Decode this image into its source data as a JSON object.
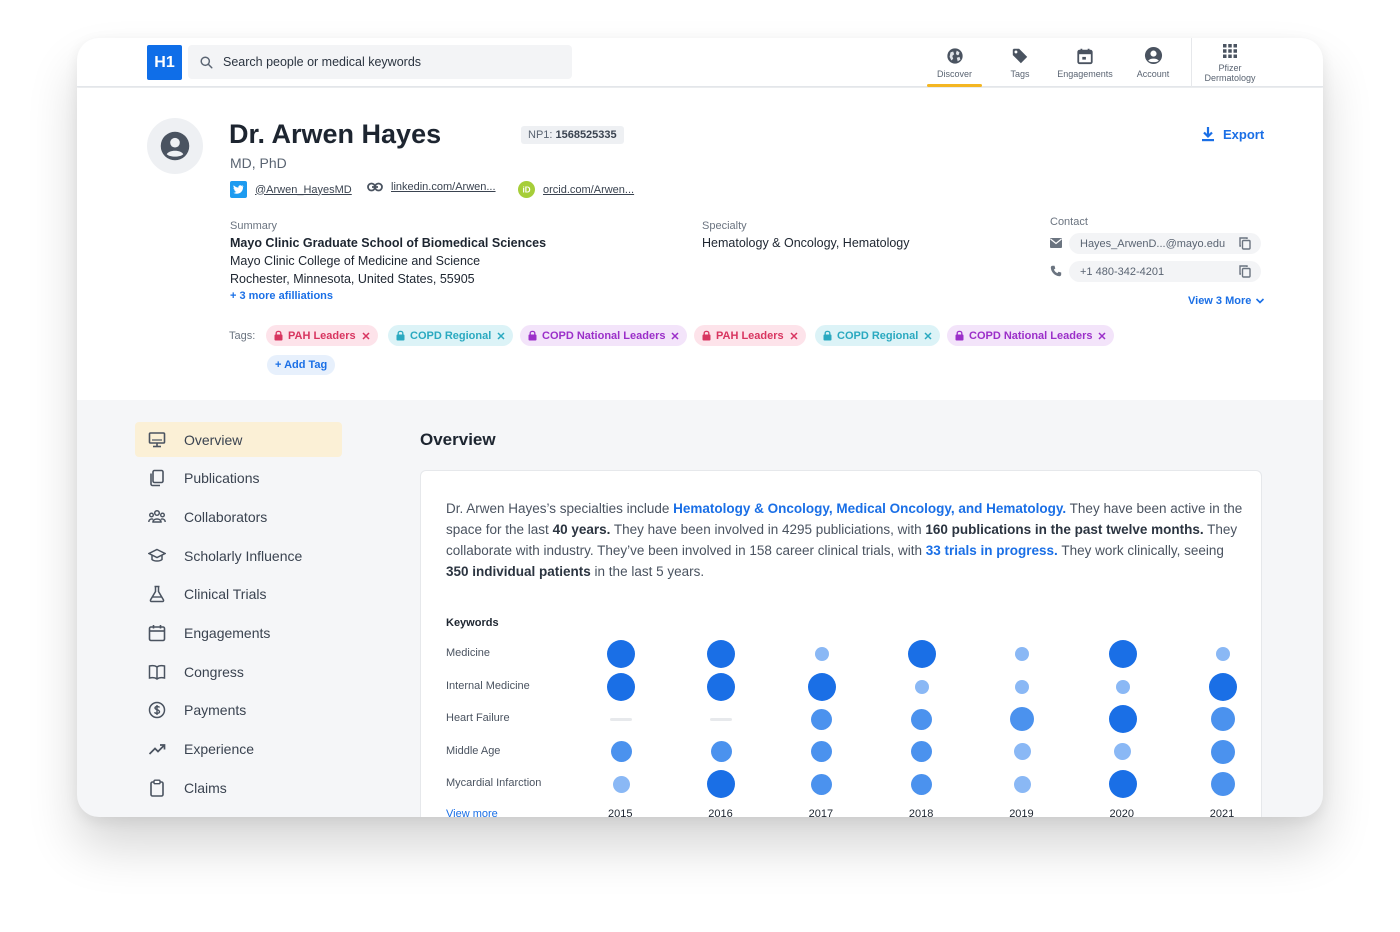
{
  "app": {
    "logo": "H1",
    "search_placeholder": "Search people or medical keywords"
  },
  "nav": [
    {
      "label": "Discover",
      "icon": "globe-icon",
      "active": true
    },
    {
      "label": "Tags",
      "icon": "tag-icon"
    },
    {
      "label": "Engagements",
      "icon": "calendar-icon"
    },
    {
      "label": "Account",
      "icon": "account-icon"
    },
    {
      "label_line1": "Pfizer",
      "label_line2": "Dermatology",
      "icon": "apps-grid-icon"
    }
  ],
  "profile": {
    "name": "Dr. Arwen Hayes",
    "degree": "MD, PhD",
    "npi_label": "NP1:",
    "npi_value": "1568525335",
    "export_label": "Export",
    "twitter": "@Arwen_HayesMD",
    "linkedin": "linkedin.com/Arwen...",
    "orcid": "orcid.com/Arwen...",
    "summary_label": "Summary",
    "summary_lines": [
      "Mayo Clinic Graduate School of Biomedical Sciences",
      "Mayo Clinic College of Medicine and Science",
      "Rochester, Minnesota, United States, 55905"
    ],
    "more_affiliations": "+ 3 more afilliations",
    "specialty_label": "Specialty",
    "specialty": "Hematology & Oncology, Hematology",
    "contact_label": "Contact",
    "email": "Hayes_ArwenD...@mayo.edu",
    "phone": "+1 480-342-4201",
    "view_more_contact": "View 3 More",
    "tags_label": "Tags:",
    "tags": [
      "PAH Leaders",
      "COPD Regional",
      "COPD National Leaders",
      "PAH Leaders",
      "COPD Regional",
      "COPD National Leaders"
    ],
    "add_tag": "+ Add Tag"
  },
  "sidebar": [
    {
      "label": "Overview",
      "icon": "monitor-icon",
      "active": true
    },
    {
      "label": "Publications",
      "icon": "documents-icon"
    },
    {
      "label": "Collaborators",
      "icon": "people-icon"
    },
    {
      "label": "Scholarly Influence",
      "icon": "graduation-cap-icon"
    },
    {
      "label": "Clinical Trials",
      "icon": "flask-icon"
    },
    {
      "label": "Engagements",
      "icon": "calendar-icon"
    },
    {
      "label": "Congress",
      "icon": "book-icon"
    },
    {
      "label": "Payments",
      "icon": "dollar-icon"
    },
    {
      "label": "Experience",
      "icon": "trend-up-icon"
    },
    {
      "label": "Claims",
      "icon": "clipboard-icon"
    }
  ],
  "overview": {
    "title": "Overview",
    "summary": {
      "t1": "Dr. Arwen Hayes’s specialties include ",
      "h1": "Hematology & Oncology, Medical Oncology, and Hematology.",
      "t2": " They have been active in the space for the last ",
      "b1": "40 years.",
      "t3": " They have been involved in 4295 publiciations, with ",
      "b2": "160 publications in the past twelve months.",
      "t4": " They collaborate with industry. They’ve been involved in 158 career clinical trials, with ",
      "h2": "33 trials in progress.",
      "t5": " They work clinically, seeing ",
      "b3": "350 individual patients",
      "t6": " in the last 5 years."
    },
    "keywords_label": "Keywords",
    "view_more": "View more"
  },
  "chart_data": {
    "type": "bubble-matrix",
    "title": "Keywords",
    "x": [
      "2015",
      "2016",
      "2017",
      "2018",
      "2019",
      "2020",
      "2021"
    ],
    "series": [
      {
        "name": "Medicine",
        "values": [
          3,
          3,
          1,
          3,
          1,
          3,
          1
        ]
      },
      {
        "name": "Internal Medicine",
        "values": [
          3,
          3,
          3,
          1,
          1,
          1,
          3
        ]
      },
      {
        "name": "Heart Failure",
        "values": [
          0,
          0,
          2,
          2,
          2.5,
          3,
          2.5
        ]
      },
      {
        "name": "Middle Age",
        "values": [
          2,
          2,
          2,
          2,
          1.5,
          1.5,
          2.5
        ]
      },
      {
        "name": "Mycardial Infarction",
        "values": [
          1.5,
          3,
          2,
          2,
          1.5,
          3,
          2.5
        ]
      }
    ],
    "colors": {
      "strong": "#1a6fe6",
      "medium": "#4b92ee",
      "light": "#8ab8f5",
      "empty": "#e7e9ec"
    }
  }
}
